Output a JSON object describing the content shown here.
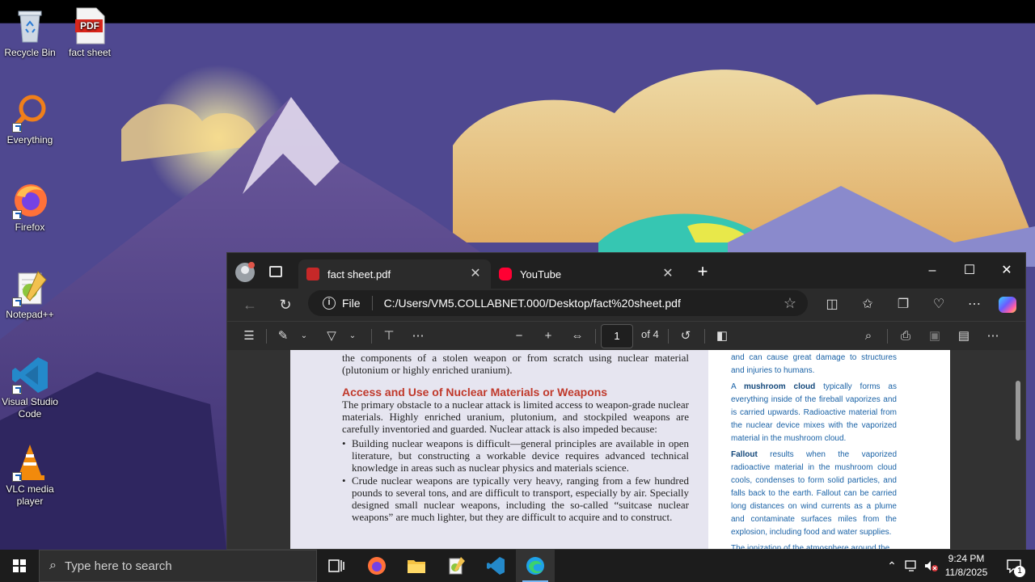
{
  "desktop": {
    "icons": [
      {
        "label": "Recycle Bin"
      },
      {
        "label": "fact sheet",
        "badge": "PDF"
      },
      {
        "label": "Everything"
      },
      {
        "label": "Firefox"
      },
      {
        "label": "Notepad++"
      },
      {
        "label": "Visual Studio Code"
      },
      {
        "label": "VLC media player"
      }
    ]
  },
  "browser": {
    "tabs": [
      {
        "label": "fact sheet.pdf",
        "active": true
      },
      {
        "label": "YouTube",
        "active": false
      }
    ],
    "address": {
      "scheme_label": "File",
      "url": "C:/Users/VM5.COLLABNET.000/Desktop/fact%20sheet.pdf"
    },
    "pdf_toolbar": {
      "page_current": "1",
      "page_total": "of 4"
    },
    "document": {
      "left_intro": "the components of a stolen weapon or from scratch using nuclear material (plutonium or highly enriched uranium).",
      "heading": "Access and Use of Nuclear Materials or Weapons",
      "paragraph": "The primary obstacle to a nuclear attack is limited access to weapon-grade nuclear materials. Highly enriched uranium, plutonium, and stockpiled weapons are carefully inventoried and guarded. Nuclear attack is also impeded because:",
      "bullets": [
        "Building nuclear weapons is difficult—general principles are available in open literature, but constructing a workable device requires advanced technical knowledge in areas such as nuclear physics and materials science.",
        "Crude nuclear weapons are typically very heavy, ranging from a few hundred pounds to several tons, and are difficult to transport, especially by air. Specially designed small nuclear weapons, including the so-called “suitcase nuclear weapons” are much lighter, but they are difficult to acquire and to construct."
      ],
      "right_p1": "and can cause great damage to structures and injuries to humans.",
      "right_p2_prefix": "A ",
      "right_p2_bold": "mushroom cloud",
      "right_p2_rest": " typically forms as everything inside of the fireball vaporizes and is carried upwards. Radioactive material from the nuclear device mixes with the vaporized material in the mushroom cloud.",
      "right_p3_bold": "Fallout",
      "right_p3_rest": " results when the vaporized radioactive material in the mushroom cloud cools, condenses to form solid particles, and falls back to the earth. Fallout can be carried long distances on wind currents as a plume and contaminate surfaces miles from the explosion, including food and water supplies.",
      "right_p4": "The ionization of the atmosphere around the"
    }
  },
  "taskbar": {
    "search_placeholder": "Type here to search",
    "time": "9:24 PM",
    "date": "11/8/2025",
    "notification_count": "1"
  }
}
